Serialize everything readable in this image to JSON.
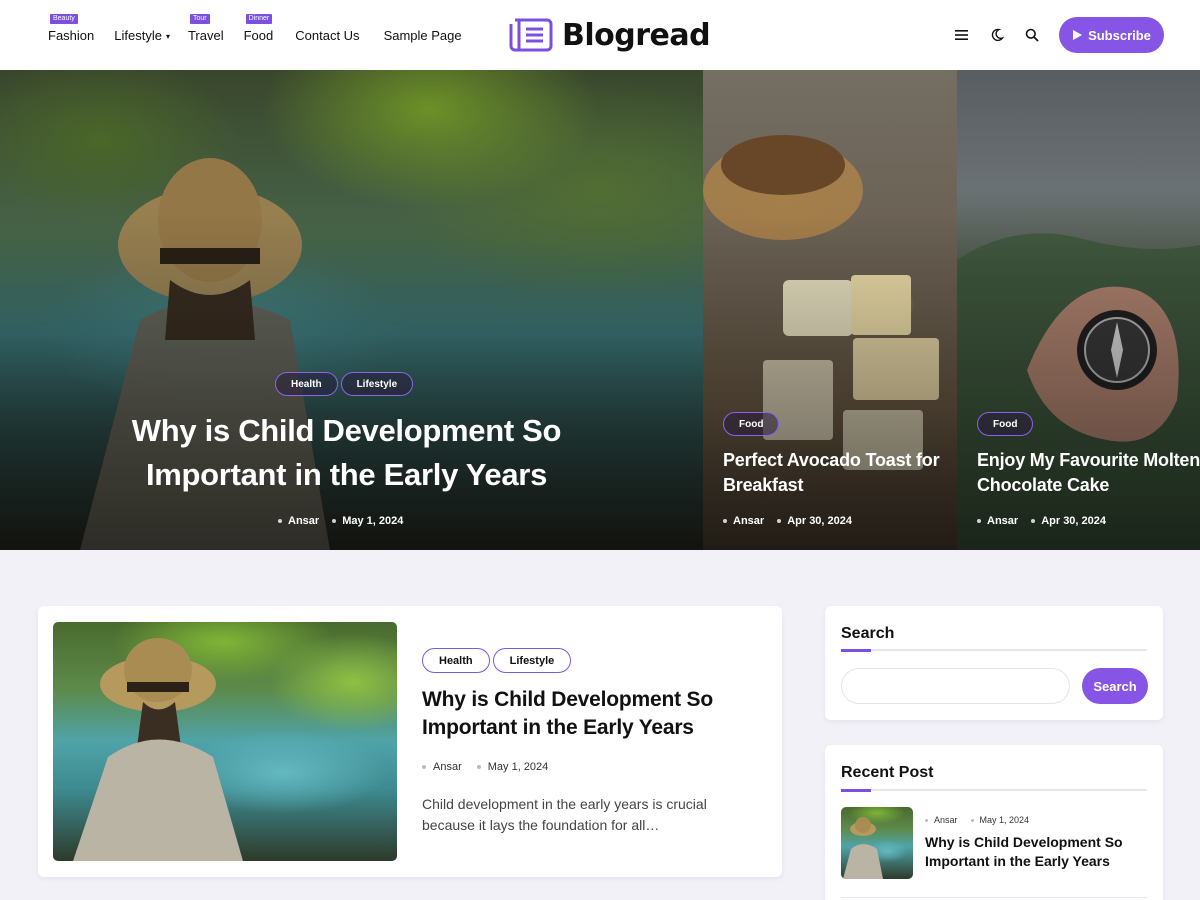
{
  "brand": {
    "name": "Blogread",
    "accent": "#8655e6"
  },
  "nav": {
    "items": [
      {
        "label": "Fashion",
        "badge": "Beauty"
      },
      {
        "label": "Lifestyle",
        "badge": ""
      },
      {
        "label": "Travel",
        "badge": "Tour"
      },
      {
        "label": "Food",
        "badge": "Dinner"
      },
      {
        "label": "Contact Us",
        "badge": ""
      },
      {
        "label": "Sample Page",
        "badge": ""
      }
    ]
  },
  "header": {
    "icons": [
      "menu-icon",
      "moon-icon",
      "search-icon"
    ],
    "subscribe_label": "Subscribe"
  },
  "hero": {
    "slides": [
      {
        "categories": [
          "Health",
          "Lifestyle"
        ],
        "title": "Why is Child Development So Important in the Early Years",
        "author": "Ansar",
        "date": "May 1, 2024"
      },
      {
        "categories": [
          "Food"
        ],
        "title": "Perfect Avocado Toast for Breakfast",
        "author": "Ansar",
        "date": "Apr 30, 2024"
      },
      {
        "categories": [
          "Food"
        ],
        "title": "Enjoy My Favourite Molten Chocolate Cake",
        "author": "Ansar",
        "date": "Apr 30, 2024"
      }
    ]
  },
  "post": {
    "categories": [
      "Health",
      "Lifestyle"
    ],
    "title": "Why is Child Development So Important in the Early Years",
    "author": "Ansar",
    "date": "May 1, 2024",
    "excerpt": "Child development in the early years is crucial because it lays the foundation for all…"
  },
  "sidebar": {
    "search": {
      "title": "Search",
      "placeholder": "",
      "button_label": "Search"
    },
    "recent": {
      "title": "Recent Post",
      "items": [
        {
          "author": "Ansar",
          "date": "May 1, 2024",
          "title": "Why is Child Development So Important in the Early Years"
        }
      ]
    }
  }
}
